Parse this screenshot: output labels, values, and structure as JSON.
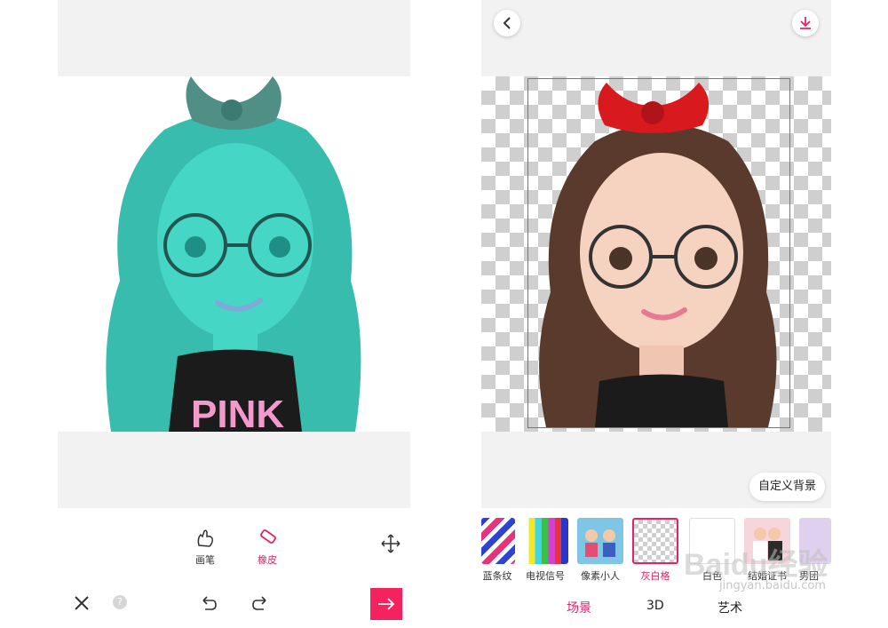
{
  "left": {
    "tools": {
      "brush_label": "画笔",
      "eraser_label": "橡皮"
    },
    "shirt_text": "PINK",
    "icons": [
      "brush-icon",
      "eraser-icon",
      "move-icon",
      "close-icon",
      "help-icon",
      "undo-icon",
      "redo-icon",
      "next-arrow-icon"
    ]
  },
  "right": {
    "custom_bg_button": "自定义背景",
    "backgrounds": [
      {
        "label": "蓝条纹"
      },
      {
        "label": "电视信号"
      },
      {
        "label": "像素小人"
      },
      {
        "label": "灰白格",
        "selected": true
      },
      {
        "label": "白色"
      },
      {
        "label": "结婚证书"
      },
      {
        "label": "男团"
      }
    ],
    "categories": [
      {
        "label": "场景",
        "active": true
      },
      {
        "label": "3D",
        "active": false
      },
      {
        "label": "艺术",
        "active": false
      }
    ],
    "icons": [
      "back-icon",
      "download-icon"
    ]
  },
  "watermark": {
    "brand": "Baidu经验",
    "url": "jingyan.baidu.com"
  },
  "colors": {
    "accent": "#e0246c",
    "teal_avatar": "#3cc7b8",
    "hair_brown": "#5a3a2c",
    "bow_red": "#d8191e",
    "annotation_arrow": "#f0262b"
  }
}
